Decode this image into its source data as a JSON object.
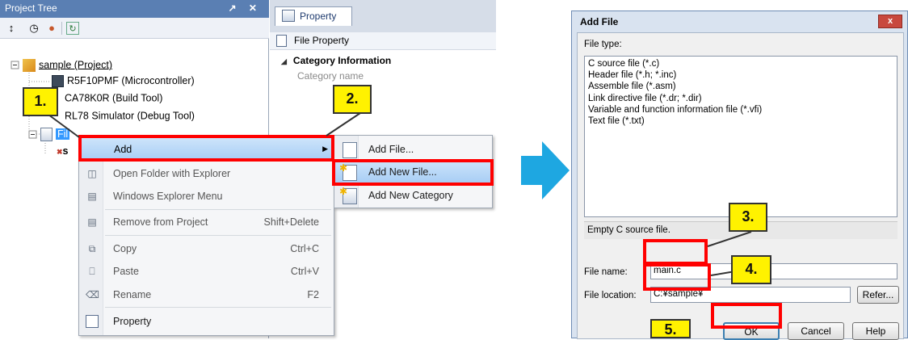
{
  "tree": {
    "title": "Project Tree",
    "title_buttons": "↗ ✕",
    "items": [
      {
        "label": "sample (Project)"
      },
      {
        "label": "R5F10PMF (Microcontroller)"
      },
      {
        "label": "CA78K0R (Build Tool)"
      },
      {
        "label": "RL78 Simulator (Debug Tool)"
      },
      {
        "label": "Fil"
      },
      {
        "label": "s"
      }
    ]
  },
  "property": {
    "tab": "Property",
    "subheader": "File Property",
    "category": "Category Information",
    "category_name": "Category name"
  },
  "context_menu": {
    "items": [
      {
        "label": "Add",
        "shortcut": "",
        "icon": "none"
      },
      {
        "label": "Open Folder with Explorer",
        "shortcut": "",
        "icon": "folder-icon"
      },
      {
        "label": "Windows Explorer Menu",
        "shortcut": "",
        "icon": "explorer-menu-icon"
      },
      {
        "label": "Remove from Project",
        "shortcut": "Shift+Delete",
        "icon": "remove-icon"
      },
      {
        "label": "Copy",
        "shortcut": "Ctrl+C",
        "icon": "copy-icon"
      },
      {
        "label": "Paste",
        "shortcut": "Ctrl+V",
        "icon": "paste-icon"
      },
      {
        "label": "Rename",
        "shortcut": "F2",
        "icon": "rename-icon"
      },
      {
        "label": "Property",
        "shortcut": "",
        "icon": "property-icon"
      }
    ],
    "submenu_arrow": "▶"
  },
  "submenu": {
    "items": [
      {
        "label": "Add File..."
      },
      {
        "label": "Add New File..."
      },
      {
        "label": "Add New Category"
      }
    ]
  },
  "dialog": {
    "title": "Add File",
    "close": "x",
    "file_type_label": "File type:",
    "file_types": [
      "C source file (*.c)",
      "Header file (*.h; *.inc)",
      "Assemble file (*.asm)",
      "Link directive file (*.dr; *.dir)",
      "Variable and function information file (*.vfi)",
      "Text file (*.txt)"
    ],
    "description": "Empty C source file.",
    "file_name_label": "File name:",
    "file_name_value": "main.c",
    "file_location_label": "File location:",
    "file_location_value": "C:¥sample¥",
    "refer_label": "Refer...",
    "ok_label": "OK",
    "cancel_label": "Cancel",
    "help_label": "Help"
  },
  "callouts": {
    "step1": "1.",
    "step2": "2.",
    "step3": "3.",
    "step4": "4.",
    "step5": "5."
  },
  "colors": {
    "highlight": "#ff0000",
    "callout": "#fff200",
    "arrow": "#1ea7e1",
    "title_bar": "#5a7fb3"
  }
}
